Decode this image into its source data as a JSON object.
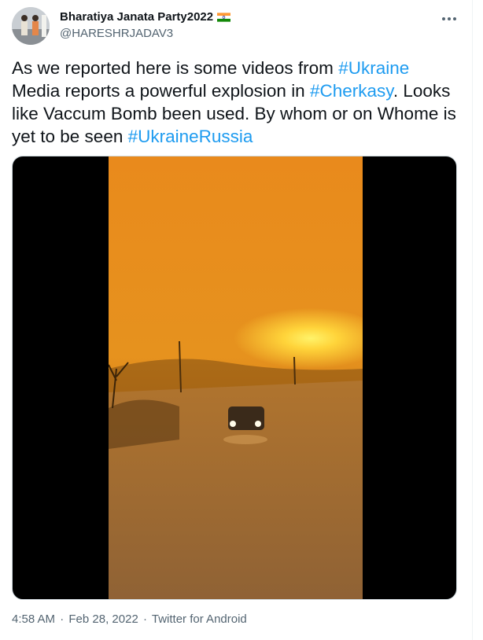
{
  "author": {
    "display_name": "Bharatiya Janata Party2022",
    "handle": "@HARESHRJADAV3",
    "badge_icon": "india-flag-icon"
  },
  "menu": {
    "icon": "more-options-icon"
  },
  "tweet": {
    "segments": [
      {
        "text": "As we reported here is some videos from ",
        "type": "text"
      },
      {
        "text": "#Ukraine",
        "type": "hashtag"
      },
      {
        "text": " Media reports a powerful explosion in ",
        "type": "text"
      },
      {
        "text": "#Cherkasy",
        "type": "hashtag"
      },
      {
        "text": ". Looks like Vaccum Bomb been used. By whom or on Whome is yet to be seen ",
        "type": "text"
      },
      {
        "text": "#UkraineRussia",
        "type": "hashtag"
      }
    ]
  },
  "media": {
    "type": "video",
    "subject": "orange sky explosion over road with car headlights"
  },
  "meta": {
    "time": "4:58 AM",
    "separator": "·",
    "date": "Feb 28, 2022",
    "source": "Twitter for Android"
  },
  "colors": {
    "link": "#1d9bf0",
    "secondary_text": "#536471",
    "primary_text": "#0f1419"
  }
}
